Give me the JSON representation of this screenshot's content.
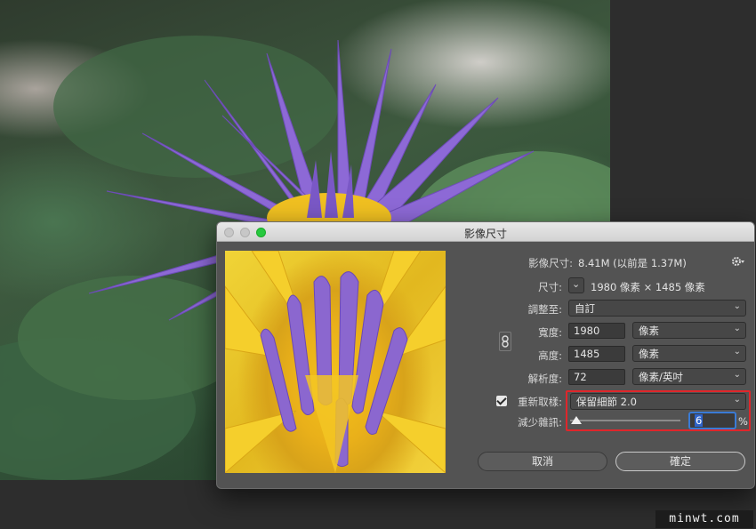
{
  "dialog": {
    "title": "影像尺寸",
    "image_size_label": "影像尺寸:",
    "image_size_value": "8.41M (以前是 1.37M)",
    "dimensions_label": "尺寸:",
    "dimensions_value": "1980 像素 × 1485 像素",
    "fit_to_label": "調整至:",
    "fit_to_value": "自訂",
    "width_label": "寬度:",
    "width_value": "1980",
    "width_unit": "像素",
    "height_label": "高度:",
    "height_value": "1485",
    "height_unit": "像素",
    "resolution_label": "解析度:",
    "resolution_value": "72",
    "resolution_unit": "像素/英吋",
    "resample_label": "重新取樣:",
    "resample_checked": true,
    "resample_value": "保留細節 2.0",
    "reduce_noise_label": "減少雜訊:",
    "reduce_noise_value": "6",
    "reduce_noise_unit": "%",
    "reduce_noise_fraction": 0.06,
    "cancel_label": "取消",
    "ok_label": "確定"
  },
  "watermark": "minwt.com",
  "colors": {
    "dialog_bg": "#535353",
    "highlight_border": "#e0262b",
    "maximize_button": "#27c93f",
    "lotus_petal": "#8e6ad6",
    "lotus_center": "#f4c21c"
  },
  "icons": {
    "gear": "gear-icon",
    "link": "link-icon",
    "chevron": "chevron-down-icon"
  }
}
